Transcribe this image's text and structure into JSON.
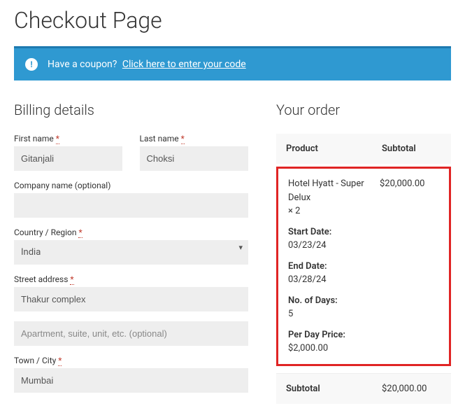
{
  "page": {
    "title": "Checkout Page"
  },
  "coupon": {
    "lead": "Have a coupon?",
    "link": "Click here to enter your code"
  },
  "billing": {
    "heading": "Billing details",
    "first_name_label": "First name",
    "first_name_value": "Gitanjali",
    "last_name_label": "Last name",
    "last_name_value": "Choksi",
    "company_label": "Company name (optional)",
    "company_value": "",
    "country_label": "Country / Region",
    "country_value": "India",
    "street_label": "Street address",
    "street_value": "Thakur complex",
    "street2_placeholder": "Apartment, suite, unit, etc. (optional)",
    "city_label": "Town / City",
    "city_value": "Mumbai",
    "required_mark": "*"
  },
  "order": {
    "heading": "Your order",
    "col_product": "Product",
    "col_subtotal": "Subtotal",
    "item": {
      "name": "Hotel Hyatt - Super Delux",
      "qty": "× 2",
      "subtotal": "$20,000.00",
      "start_date_label": "Start Date:",
      "start_date_value": "03/23/24",
      "end_date_label": "End Date:",
      "end_date_value": "03/28/24",
      "days_label": "No. of Days:",
      "days_value": "5",
      "per_day_label": "Per Day Price:",
      "per_day_value": "$2,000.00"
    },
    "subtotal_label": "Subtotal",
    "subtotal_value": "$20,000.00"
  }
}
